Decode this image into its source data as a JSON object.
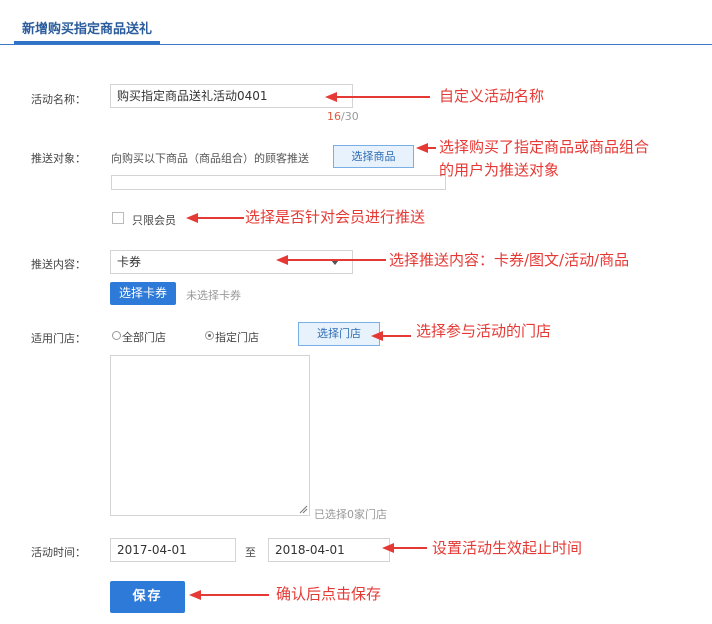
{
  "tab": {
    "title": "新增购买指定商品送礼"
  },
  "form": {
    "activity_name": {
      "label": "活动名称：",
      "value": "购买指定商品送礼活动0401",
      "count_current": "16",
      "count_total": "/30"
    },
    "target": {
      "label": "推送对象：",
      "text": "向购买以下商品（商品组合）的顾客推送",
      "button": "选择商品"
    },
    "members_only": {
      "label": "只限会员"
    },
    "content": {
      "label": "推送内容：",
      "selected": "卡券",
      "button": "选择卡券",
      "status": "未选择卡券"
    },
    "stores": {
      "label": "适用门店：",
      "option_all": "全部门店",
      "option_specific": "指定门店",
      "button": "选择门店",
      "selected_count": "已选择0家门店"
    },
    "time": {
      "label": "活动时间：",
      "start": "2017-04-01",
      "separator": "至",
      "end": "2018-04-01"
    },
    "save_button": "保存"
  },
  "annotations": {
    "name": "自定义活动名称",
    "target_line1": "选择购买了指定商品或商品组合",
    "target_line2": "的用户为推送对象",
    "member": "选择是否针对会员进行推送",
    "content": "选择推送内容：卡券/图文/活动/商品",
    "stores": "选择参与活动的门店",
    "time": "设置活动生效起止时间",
    "save": "确认后点击保存"
  },
  "colors": {
    "accent": "#2d7ad8",
    "annotation": "#e53935",
    "count_current": "#e05a3c"
  }
}
